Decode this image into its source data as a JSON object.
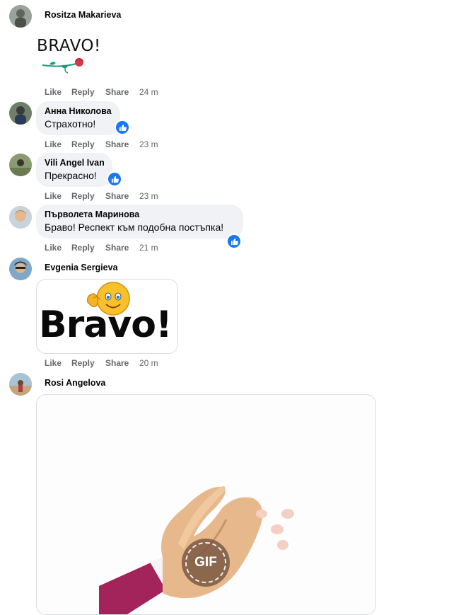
{
  "actions": {
    "like": "Like",
    "reply": "Reply",
    "share": "Share"
  },
  "comments": [
    {
      "author": "Rositza Makarieva",
      "sticker_text": "BRAVO!",
      "time": "24 m"
    },
    {
      "author": "Анна Николова",
      "text": "Страхотно!",
      "time": "23 m"
    },
    {
      "author": "Vili Angel Ivan",
      "text": "Прекрасно!",
      "time": "23 m"
    },
    {
      "author": "Първолета Маринова",
      "text": "Браво! Респект към подобна постъпка!",
      "time": "21 m"
    },
    {
      "author": "Evgenia Sergieva",
      "sticker_text": "Bravo!",
      "time": "20 m"
    },
    {
      "author": "Rosi Angelova",
      "gif_label": "GIF"
    }
  ],
  "colors": {
    "like_blue": "#1877f2",
    "bubble_bg": "#f0f2f5",
    "meta_gray": "#65676b"
  }
}
